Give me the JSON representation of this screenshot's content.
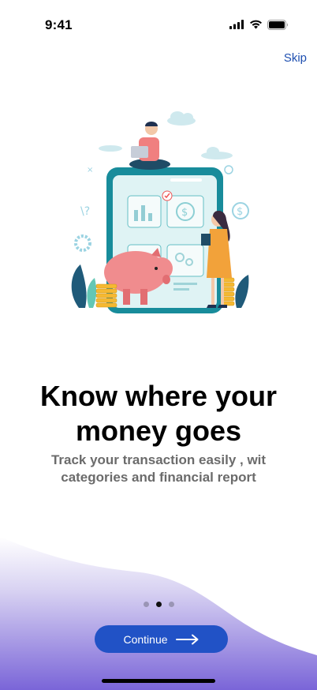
{
  "status": {
    "time": "9:41"
  },
  "header": {
    "skip_label": "Skip"
  },
  "onboarding": {
    "title_line1": "Know where your",
    "title_line2": "money goes",
    "subtitle_line1": "Track your transaction easily , wit",
    "subtitle_line2": "categories and financial report"
  },
  "pagination": {
    "total": 3,
    "active_index": 1
  },
  "actions": {
    "continue_label": "Continue"
  },
  "colors": {
    "accent": "#2152c6",
    "skip": "#1e4fb0",
    "wave_top": "#ffffff",
    "wave_bottom": "#7a65d8"
  },
  "icons": {
    "signal": "cellular-signal-icon",
    "wifi": "wifi-icon",
    "battery": "battery-icon",
    "arrow": "arrow-right-icon"
  }
}
